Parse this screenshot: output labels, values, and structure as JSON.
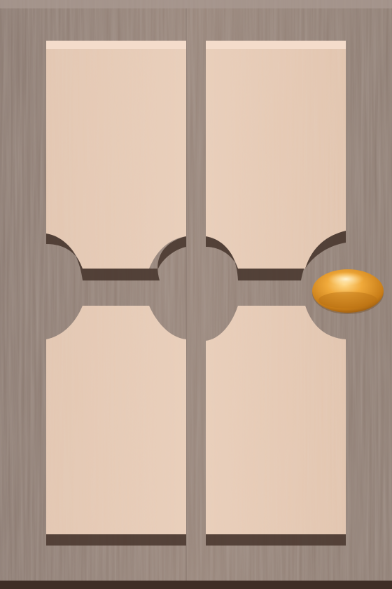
{
  "theme": {
    "board_color": "#8f7e74",
    "panel_color": "#e6c9b3",
    "groove_shadow": "#4a3830",
    "knob_color": "#e09a2a"
  },
  "icons": {
    "knob": "amber-oval-knob-icon"
  }
}
